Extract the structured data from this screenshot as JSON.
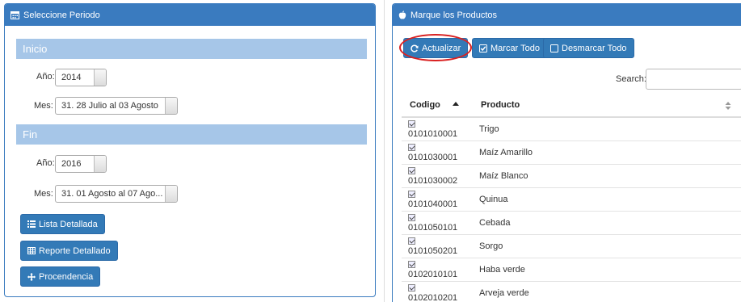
{
  "left_panel": {
    "title": "Seleccione Periodo",
    "inicio": {
      "section_title": "Inicio",
      "anio_label": "Año:",
      "anio_value": "2014",
      "mes_label": "Mes:",
      "mes_value": "31. 28 Julio al 03 Agosto"
    },
    "fin": {
      "section_title": "Fin",
      "anio_label": "Año:",
      "anio_value": "2016",
      "mes_label": "Mes:",
      "mes_value": "31. 01 Agosto al 07 Ago..."
    },
    "buttons": {
      "lista": "Lista Detallada",
      "reporte": "Reporte Detallado",
      "procedencia": "Procendencia"
    }
  },
  "right_panel": {
    "title": "Marque los Productos",
    "buttons": {
      "actualizar": "Actualizar",
      "marcar": "Marcar Todo",
      "desmarcar": "Desmarcar Todo"
    },
    "search_label": "Search:",
    "search_value": "",
    "table": {
      "headers": [
        "Codigo",
        "Producto"
      ],
      "rows": [
        {
          "codigo": "0101010001",
          "producto": "Trigo"
        },
        {
          "codigo": "0101030001",
          "producto": "Maíz Amarillo"
        },
        {
          "codigo": "0101030002",
          "producto": "Maíz Blanco"
        },
        {
          "codigo": "0101040001",
          "producto": "Quinua"
        },
        {
          "codigo": "0101050101",
          "producto": "Cebada"
        },
        {
          "codigo": "0101050201",
          "producto": "Sorgo"
        },
        {
          "codigo": "0102010101",
          "producto": "Haba verde"
        },
        {
          "codigo": "0102010201",
          "producto": "Arveja verde"
        }
      ]
    }
  },
  "colors": {
    "panel_header": "#3a7bbf",
    "section_bar": "#a6c6e8",
    "button": "#337ab7",
    "highlight": "#d92020"
  }
}
